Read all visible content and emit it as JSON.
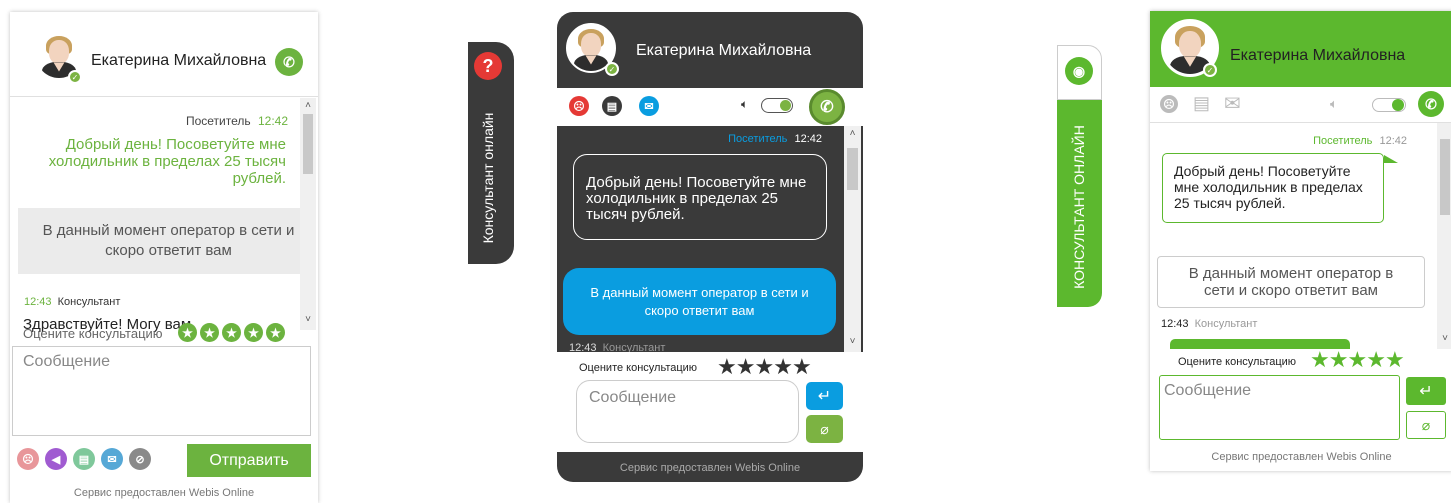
{
  "w1": {
    "operator_name": "Екатерина Михайловна",
    "visitor_label": "Посетитель",
    "visitor_time": "12:42",
    "visitor_message": "Добрый день! Посоветуйте мне холодильник в пределах 25 тысяч рублей.",
    "system_message": "В данный момент оператор в сети и скоро ответит вам",
    "consultant_time": "12:43",
    "consultant_label": "Консультант",
    "consultant_message": "Здравствуйте! Могу вам",
    "rate_label": "Оцените консультацию",
    "message_placeholder": "Сообщение",
    "send_label": "Отправить",
    "footer": "Сервис предоставлен Webis Online",
    "colors": {
      "accent": "#6cb33f",
      "system_bg": "#ebebeb"
    }
  },
  "tab2": {
    "label": "Консультант онлайн",
    "icon": "question-icon"
  },
  "w2": {
    "operator_name": "Екатерина Михайловна",
    "visitor_label": "Посетитель",
    "visitor_time": "12:42",
    "visitor_message": "Добрый день! Посоветуйте мне холодильник в пределах 25 тысяч рублей.",
    "system_message": "В данный момент оператор в сети и скоро ответит вам",
    "consultant_time": "12:43",
    "consultant_label": "Консультант",
    "rate_label": "Оцените консультацию",
    "message_placeholder": "Сообщение",
    "footer": "Сервис предоставлен Webis Online",
    "colors": {
      "bg": "#3a3a3a",
      "system_bg": "#0a9de0",
      "call": "#7cb342"
    }
  },
  "tab3": {
    "label": "КОНСУЛЬТАНТ ОНЛАЙН",
    "icon": "chat-bubbles-icon"
  },
  "w3": {
    "operator_name": "Екатерина Михайловна",
    "visitor_label": "Посетитель",
    "visitor_time": "12:42",
    "visitor_message": "Добрый день! Посоветуйте мне холодильник в пределах 25 тысяч рублей.",
    "system_message": "В данный момент оператор в сети и скоро ответит вам",
    "consultant_time": "12:43",
    "consultant_label": "Консультант",
    "rate_label": "Оцените консультацию",
    "message_placeholder": "Сообщение",
    "footer": "Сервис предоставлен Webis Online",
    "colors": {
      "accent": "#5cb82e"
    }
  }
}
